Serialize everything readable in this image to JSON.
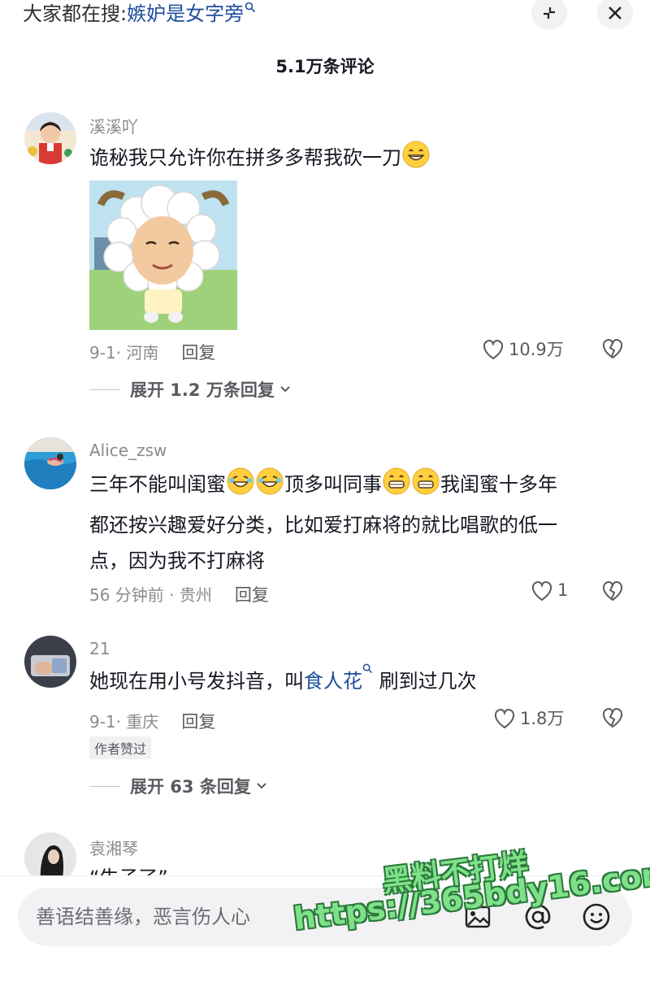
{
  "header": {
    "hot_search_prefix": "大家都在搜:",
    "hot_search_term": "嫉妒是女字旁",
    "comment_count": "5.1万条评论"
  },
  "comments": [
    {
      "username": "溪溪吖",
      "text": "诡秘我只允许你在拼多多帮我砍一刀",
      "meta": "9-1· 河南",
      "reply_label": "回复",
      "likes": "10.9万",
      "expand": "展开 1.2 万条回复"
    },
    {
      "username": "Alice_zsw",
      "text_a": "三年不能叫闺蜜",
      "text_b": "顶多叫同事",
      "text_c": "我闺蜜十多年",
      "text_line2": "都还按兴趣爱好分类，比如爱打麻将的就比唱歌的低一",
      "text_line3": "点，因为我不打麻将",
      "meta": "56 分钟前 · 贵州",
      "reply_label": "回复",
      "likes": "1"
    },
    {
      "username": "21",
      "text_a": "她现在用小号发抖音，叫",
      "text_link": "食人花",
      "text_b": " 刷到过几次",
      "meta": "9-1· 重庆",
      "reply_label": "回复",
      "likes": "1.8万",
      "badge": "作者赞过",
      "expand": "展开 63 条回复"
    },
    {
      "username": "袁湘琴",
      "text_partial": "“牛子了”"
    }
  ],
  "input": {
    "placeholder": "善语结善缘，恶言伤人心"
  },
  "watermark": {
    "line1": "黑料不打烊",
    "line2": "https://365bdy16.com"
  },
  "colors": {
    "link": "#1f4e9c",
    "secondary_text": "#8a8b91",
    "primary_text": "#161823",
    "watermark": "#7fe08a"
  }
}
